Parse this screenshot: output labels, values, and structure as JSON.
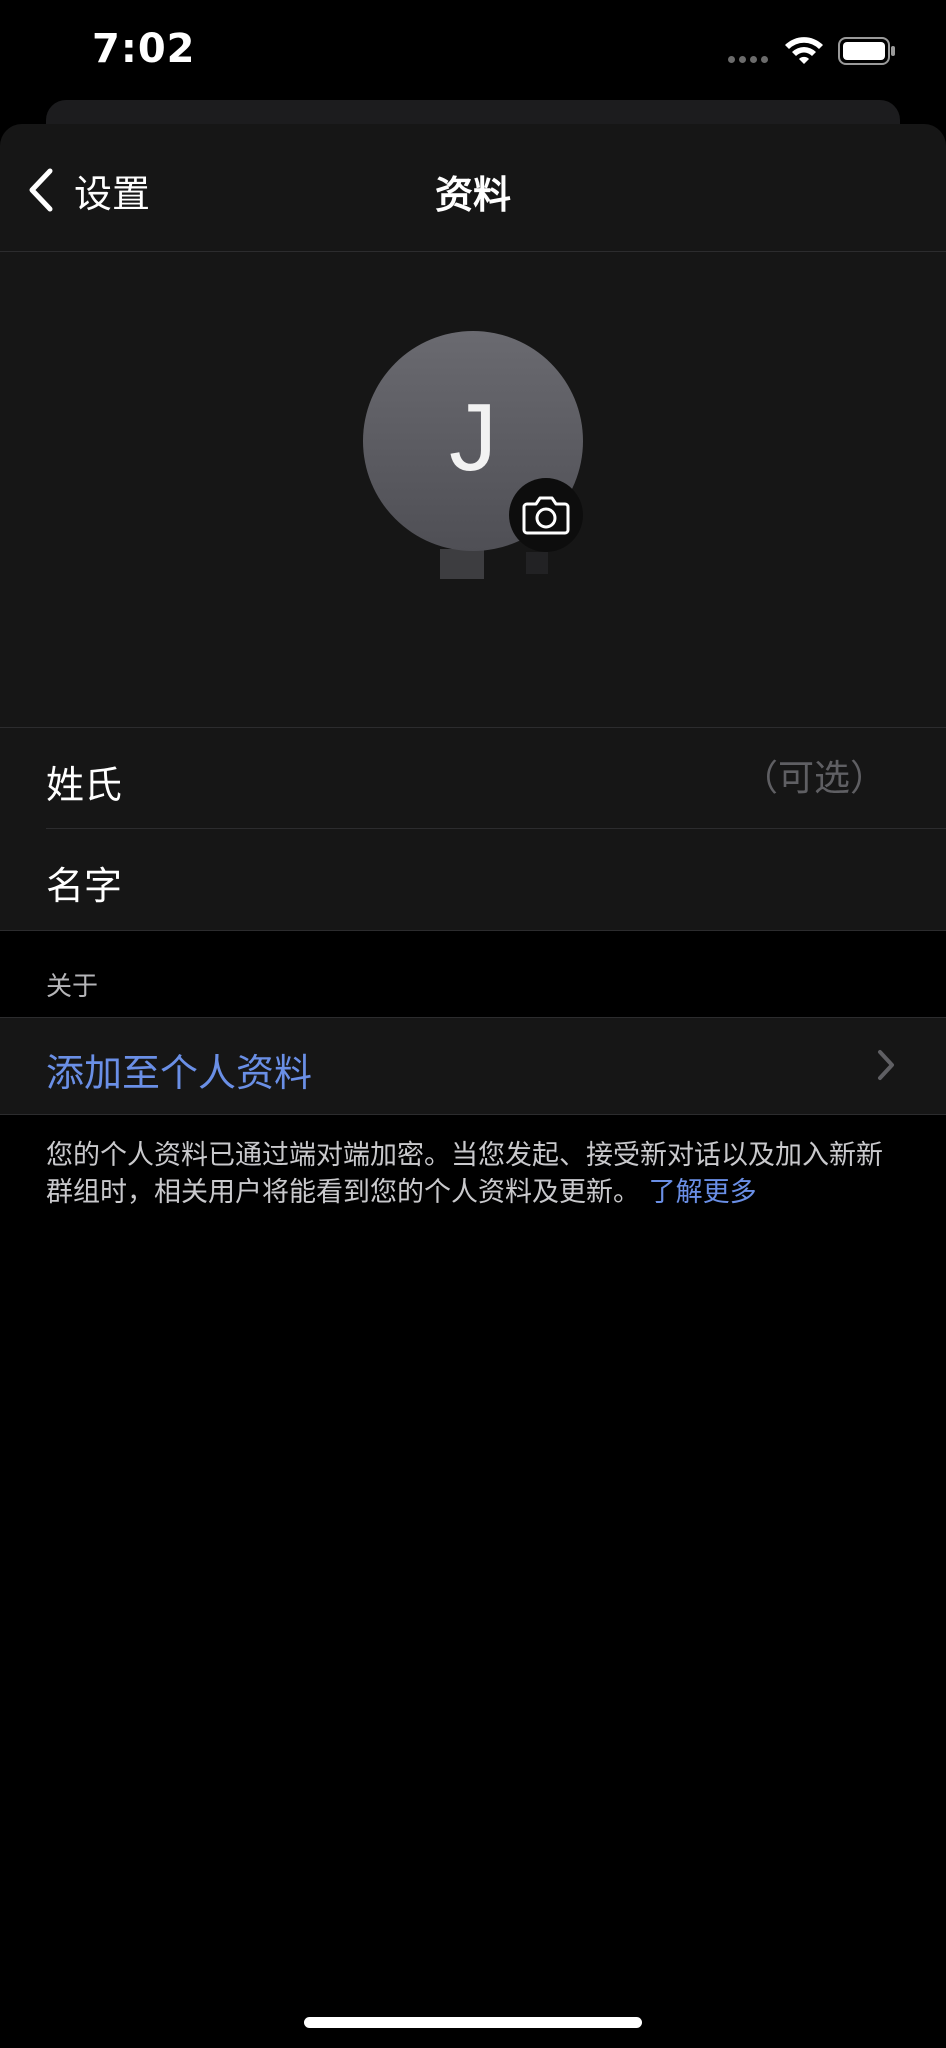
{
  "status_bar": {
    "time": "7:02"
  },
  "nav": {
    "back_label": "设置",
    "title": "资料"
  },
  "avatar": {
    "initial": "J",
    "color": "#5f5f65"
  },
  "fields": {
    "last_name": {
      "label": "姓氏",
      "value": "",
      "placeholder": "（可选）"
    },
    "first_name": {
      "label": "名字",
      "value": "",
      "placeholder": ""
    }
  },
  "about": {
    "header": "关于",
    "add_label": "添加至个人资料"
  },
  "footnote": {
    "text": "您的个人资料已通过端对端加密。当您发起、接受新对话以及加入新新群组时，相关用户将能看到您的个人资料及更新。",
    "link": "了解更多"
  },
  "colors": {
    "accent": "#6a8fe6",
    "background": "#000000",
    "surface": "#161616"
  }
}
